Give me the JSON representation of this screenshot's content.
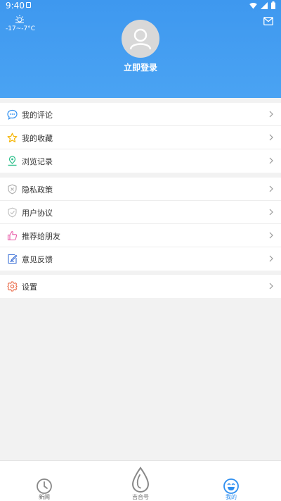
{
  "status_bar": {
    "time": "9:40"
  },
  "header": {
    "weather_temp": "-17~-7°C",
    "login_label": "立即登录"
  },
  "menu_group_1": {
    "items": [
      {
        "label": "我的评论",
        "icon": "comment-icon",
        "color": "#2f8ff0"
      },
      {
        "label": "我的收藏",
        "icon": "star-icon",
        "color": "#f5b400"
      },
      {
        "label": "浏览记录",
        "icon": "location-history-icon",
        "color": "#2bbf8a"
      }
    ]
  },
  "menu_group_2": {
    "items": [
      {
        "label": "隐私政策",
        "icon": "privacy-shield-icon",
        "color": "#aaaaaa"
      },
      {
        "label": "用户协议",
        "icon": "agreement-shield-icon",
        "color": "#aaaaaa"
      },
      {
        "label": "推荐给朋友",
        "icon": "thumbs-up-icon",
        "color": "#e85aa8"
      },
      {
        "label": "意见反馈",
        "icon": "feedback-icon",
        "color": "#3b6fd6"
      }
    ]
  },
  "menu_group_3": {
    "items": [
      {
        "label": "设置",
        "icon": "gear-icon",
        "color": "#e8603c"
      }
    ]
  },
  "bottom_nav": {
    "items": [
      {
        "label": "新闻",
        "icon": "clock-icon",
        "active": false
      },
      {
        "label": "吉合号",
        "icon": "droplet-icon",
        "active": false
      },
      {
        "label": "我的",
        "icon": "smile-icon",
        "active": true
      }
    ],
    "active_color": "#2f8ff0"
  }
}
